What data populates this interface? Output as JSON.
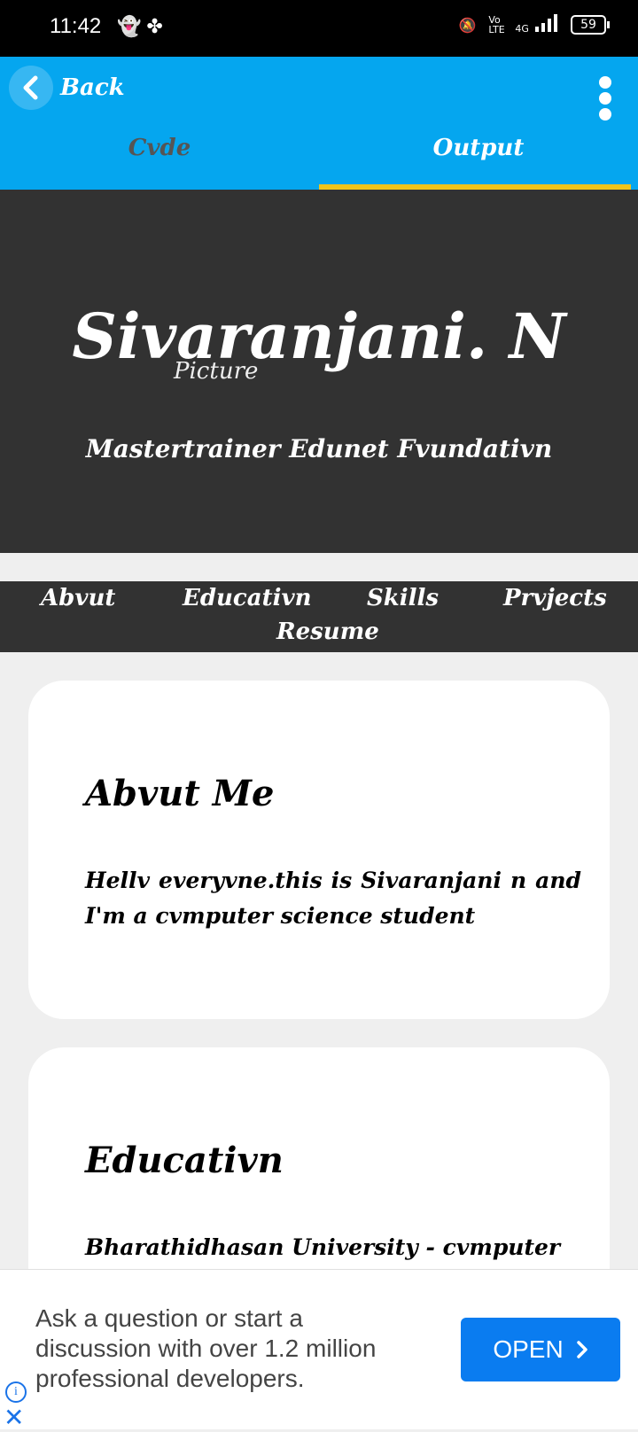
{
  "status_bar": {
    "time": "11:42",
    "battery": "59",
    "network": "4G",
    "volte": "Vo LTE"
  },
  "app_bar": {
    "back_label": "Back",
    "tabs": [
      {
        "label": "Cvde",
        "active": false
      },
      {
        "label": "Output",
        "active": true
      }
    ]
  },
  "hero": {
    "name": "Sivaranjani. N",
    "image_alt": "Picture",
    "role": "Mastertrainer Edunet Fvundativn"
  },
  "nav": {
    "items": [
      "Abvut",
      "Educativn",
      "Skills",
      "Prvjects",
      "Resume"
    ]
  },
  "about": {
    "title": "Abvut Me",
    "text": "Hellv everyvne.this is Sivaranjani n and I'm a cvmputer science student"
  },
  "education": {
    "title": "Educativn",
    "text": "Bharathidhasan University - cvmputer"
  },
  "ad": {
    "text": "Ask a question or start a discussion with over 1.2 million professional developers.",
    "button_label": "OPEN"
  },
  "colors": {
    "app_bar": "#05a6ef",
    "tab_indicator": "#f0c419",
    "hero_bg": "#323232",
    "page_bg": "#efefef",
    "ad_button": "#0a7cf0"
  }
}
